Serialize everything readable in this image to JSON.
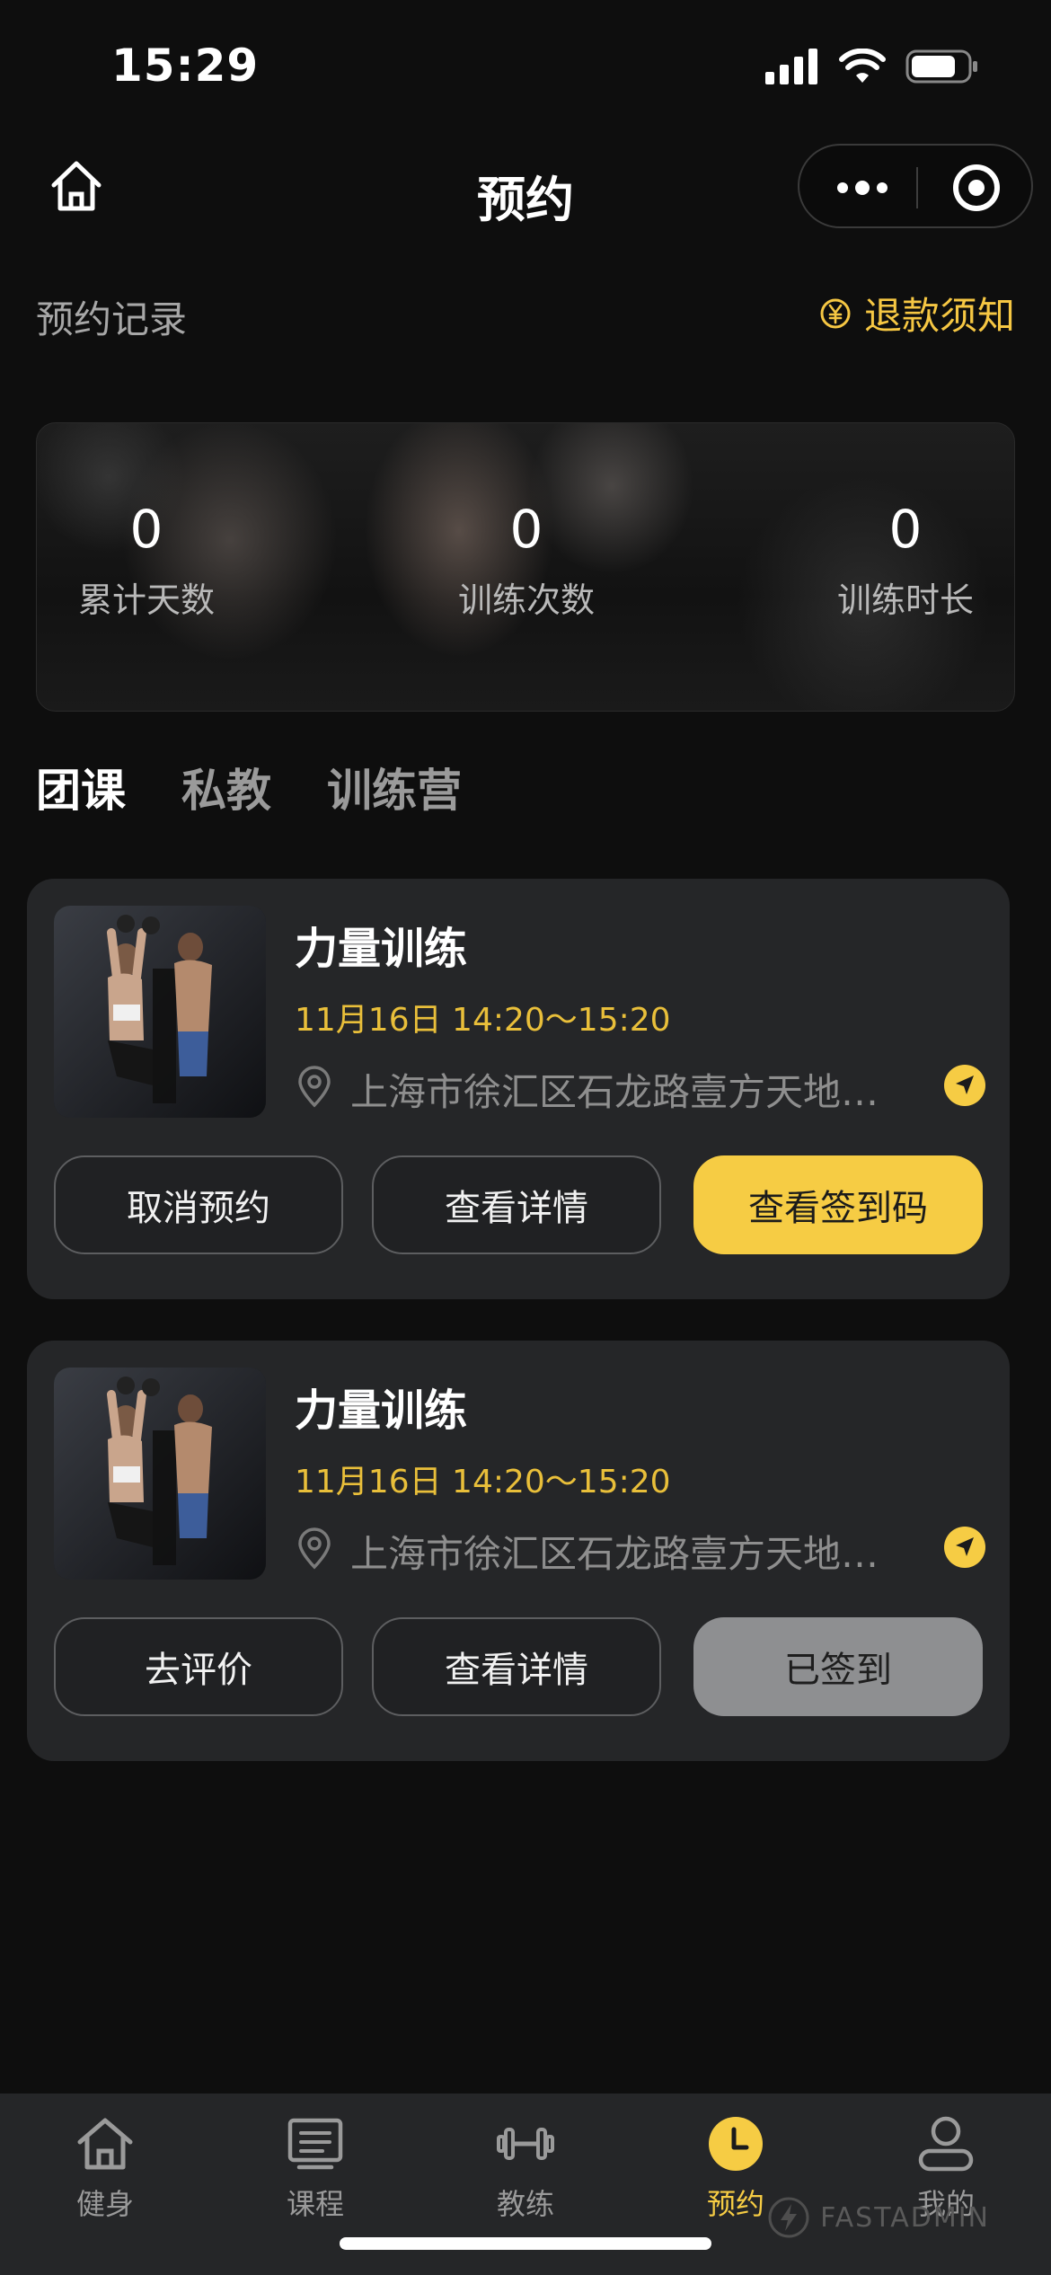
{
  "status_bar": {
    "time": "15:29"
  },
  "nav": {
    "title": "预约"
  },
  "records": {
    "title": "预约记录",
    "refund_label": "退款须知",
    "refund_icon": "yen-circle-icon"
  },
  "stats": [
    {
      "value": "0",
      "label": "累计天数"
    },
    {
      "value": "0",
      "label": "训练次数"
    },
    {
      "value": "0",
      "label": "训练时长"
    }
  ],
  "tabs": [
    {
      "label": "团课",
      "active": true
    },
    {
      "label": "私教",
      "active": false
    },
    {
      "label": "训练营",
      "active": false
    }
  ],
  "cards": [
    {
      "title": "力量训练",
      "time": "11月16日 14:20～15:20",
      "address": "上海市徐汇区石龙路壹方天地…",
      "buttons": [
        "取消预约",
        "查看详情",
        "查看签到码"
      ]
    },
    {
      "title": "力量训练",
      "time": "11月16日 14:20～15:20",
      "address": "上海市徐汇区石龙路壹方天地…",
      "buttons": [
        "去评价",
        "查看详情",
        "已签到"
      ]
    }
  ],
  "tabbar": [
    {
      "label": "健身",
      "icon": "home-icon"
    },
    {
      "label": "课程",
      "icon": "list-icon"
    },
    {
      "label": "教练",
      "icon": "dumbbell-icon"
    },
    {
      "label": "预约",
      "icon": "clock-icon",
      "active": true
    },
    {
      "label": "我的",
      "icon": "user-icon"
    }
  ],
  "watermark": "FASTADMIN",
  "colors": {
    "accent": "#f6cc44",
    "background": "#0e0e0e",
    "card": "#252628"
  }
}
